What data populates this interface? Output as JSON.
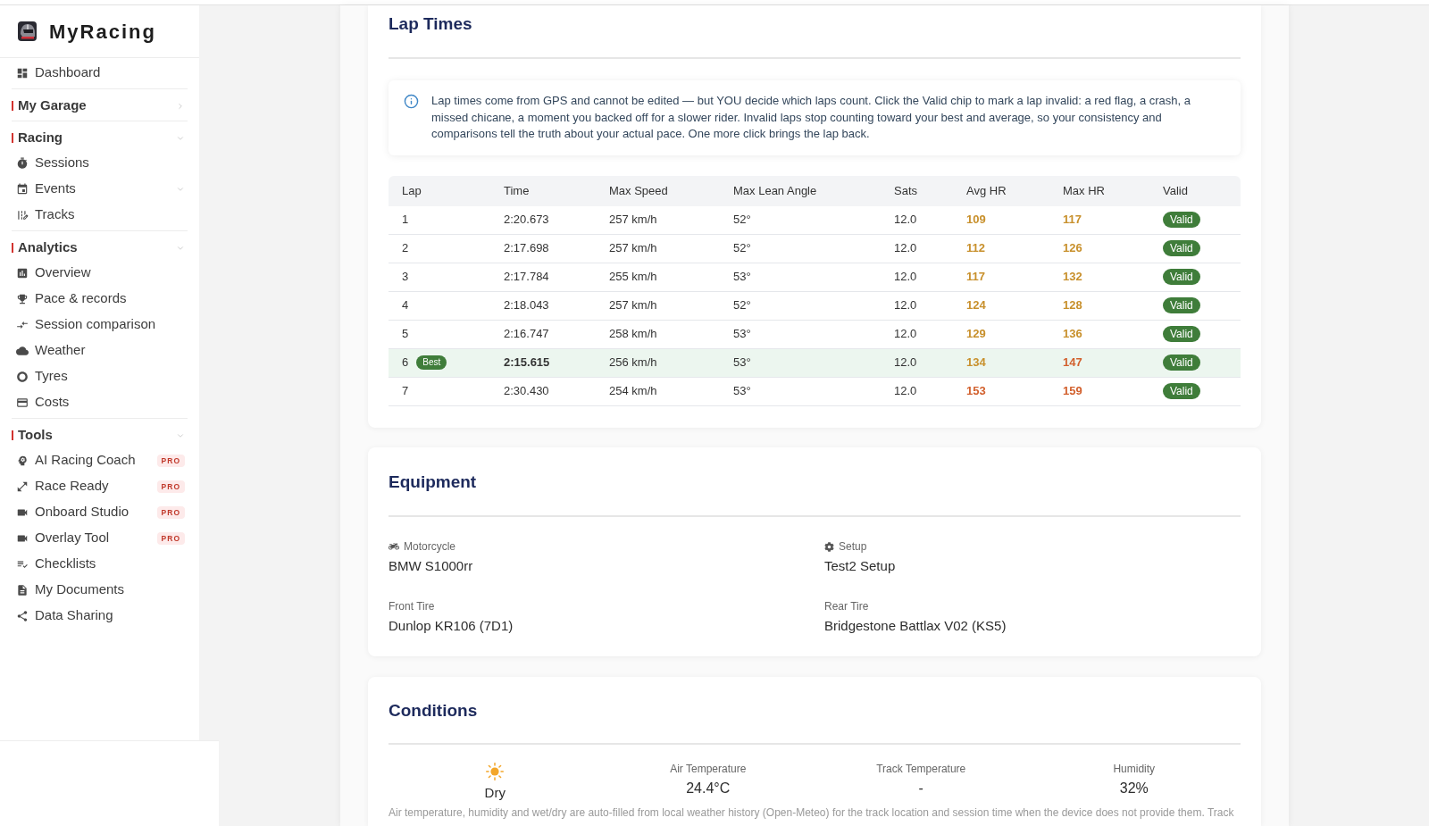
{
  "sidebar": {
    "brand": "MyRacing",
    "groups": [
      {
        "kind": "link",
        "label": "Dashboard"
      },
      {
        "kind": "section",
        "label": "My Garage",
        "expanded": false
      },
      {
        "kind": "section",
        "label": "Racing",
        "expanded": true,
        "children": [
          {
            "label": "Sessions"
          },
          {
            "label": "Events",
            "submenu": true
          },
          {
            "label": "Tracks"
          }
        ]
      },
      {
        "kind": "section",
        "label": "Analytics",
        "expanded": true,
        "children": [
          {
            "label": "Overview"
          },
          {
            "label": "Pace & records"
          },
          {
            "label": "Session comparison"
          },
          {
            "label": "Weather"
          },
          {
            "label": "Tyres"
          },
          {
            "label": "Costs"
          }
        ]
      },
      {
        "kind": "section",
        "label": "Tools",
        "expanded": true,
        "children": [
          {
            "label": "AI Racing Coach",
            "badge": "PRO"
          },
          {
            "label": "Race Ready",
            "badge": "PRO"
          },
          {
            "label": "Onboard Studio",
            "badge": "PRO"
          },
          {
            "label": "Overlay Tool",
            "badge": "PRO"
          },
          {
            "label": "Checklists"
          },
          {
            "label": "My Documents"
          },
          {
            "label": "Data Sharing"
          }
        ]
      }
    ]
  },
  "lap_times": {
    "title": "Lap Times",
    "info": "Lap times come from GPS and cannot be edited — but YOU decide which laps count. Click the Valid chip to mark a lap invalid: a red flag, a crash, a missed chicane, a moment you backed off for a slower rider. Invalid laps stop counting toward your best and average, so your consistency and comparisons tell the truth about your actual pace. One more click brings the lap back.",
    "columns": [
      "Lap",
      "Time",
      "Max Speed",
      "Max Lean Angle",
      "Sats",
      "Avg HR",
      "Max HR",
      "Valid"
    ],
    "rows": [
      {
        "lap": "1",
        "time": "2:20.673",
        "max_speed": "257 km/h",
        "max_lean": "52°",
        "sats": "12.0",
        "avg_hr": {
          "text": "109",
          "color": "#c8902c"
        },
        "max_hr": {
          "text": "117",
          "color": "#c8902c"
        },
        "valid": true,
        "valid_label": "Valid",
        "best": false
      },
      {
        "lap": "2",
        "time": "2:17.698",
        "max_speed": "257 km/h",
        "max_lean": "52°",
        "sats": "12.0",
        "avg_hr": {
          "text": "112",
          "color": "#c8902c"
        },
        "max_hr": {
          "text": "126",
          "color": "#c8902c"
        },
        "valid": true,
        "valid_label": "Valid",
        "best": false
      },
      {
        "lap": "3",
        "time": "2:17.784",
        "max_speed": "255 km/h",
        "max_lean": "53°",
        "sats": "12.0",
        "avg_hr": {
          "text": "117",
          "color": "#c8902c"
        },
        "max_hr": {
          "text": "132",
          "color": "#c8902c"
        },
        "valid": true,
        "valid_label": "Valid",
        "best": false
      },
      {
        "lap": "4",
        "time": "2:18.043",
        "max_speed": "257 km/h",
        "max_lean": "52°",
        "sats": "12.0",
        "avg_hr": {
          "text": "124",
          "color": "#c8902c"
        },
        "max_hr": {
          "text": "128",
          "color": "#c8902c"
        },
        "valid": true,
        "valid_label": "Valid",
        "best": false
      },
      {
        "lap": "5",
        "time": "2:16.747",
        "max_speed": "258 km/h",
        "max_lean": "53°",
        "sats": "12.0",
        "avg_hr": {
          "text": "129",
          "color": "#c8902c"
        },
        "max_hr": {
          "text": "136",
          "color": "#c8902c"
        },
        "valid": true,
        "valid_label": "Valid",
        "best": false
      },
      {
        "lap": "6",
        "best_label": "Best",
        "time": "2:15.615",
        "max_speed": "256 km/h",
        "max_lean": "53°",
        "sats": "12.0",
        "avg_hr": {
          "text": "134",
          "color": "#c8902c"
        },
        "max_hr": {
          "text": "147",
          "color": "#d2602d"
        },
        "valid": true,
        "valid_label": "Valid",
        "best": true
      },
      {
        "lap": "7",
        "time": "2:30.430",
        "max_speed": "254 km/h",
        "max_lean": "53°",
        "sats": "12.0",
        "avg_hr": {
          "text": "153",
          "color": "#d2602d"
        },
        "max_hr": {
          "text": "159",
          "color": "#d2602d"
        },
        "valid": true,
        "valid_label": "Valid",
        "best": false
      }
    ]
  },
  "equipment": {
    "title": "Equipment",
    "fields": [
      {
        "kind": "motorcycle",
        "label": "Motorcycle",
        "value": "BMW S1000rr"
      },
      {
        "kind": "setup",
        "label": "Setup",
        "value": "Test2 Setup"
      },
      {
        "kind": "plain",
        "label": "Front Tire",
        "value": "Dunlop KR106 (7D1)"
      },
      {
        "kind": "plain",
        "label": "Rear Tire",
        "value": "Bridgestone Battlax V02 (KS5)"
      }
    ]
  },
  "conditions": {
    "title": "Conditions",
    "surface": {
      "kind": "sun",
      "label": "Dry"
    },
    "stats": [
      {
        "label": "Air Temperature",
        "value": "24.4°C"
      },
      {
        "label": "Track Temperature",
        "value": "-"
      },
      {
        "label": "Humidity",
        "value": "32%"
      }
    ],
    "note": "Air temperature, humidity and wet/dry are auto-filled from local weather history (Open-Meteo) for the track location and session time when the device does not provide them. Track"
  }
}
